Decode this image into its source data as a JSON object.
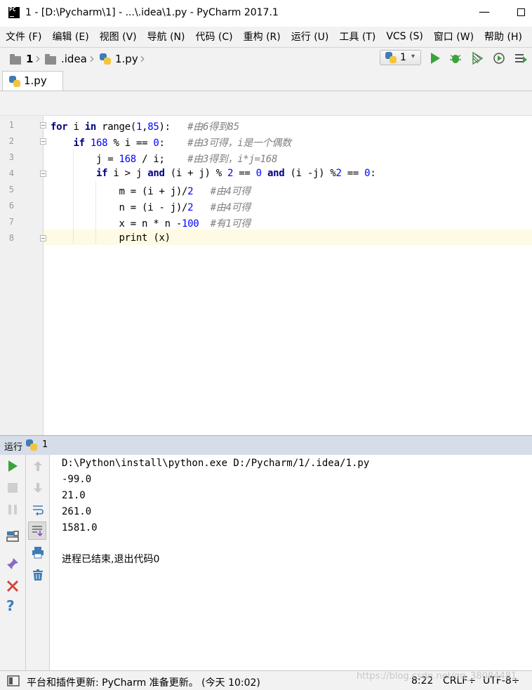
{
  "window": {
    "title": "1 - [D:\\Pycharm\\1] - ...\\.idea\\1.py - PyCharm 2017.1",
    "logo_text": "PC",
    "minimize_glyph": "—"
  },
  "menu": [
    "文件 (F)",
    "编辑 (E)",
    "视图 (V)",
    "导航 (N)",
    "代码 (C)",
    "重构 (R)",
    "运行 (U)",
    "工具 (T)",
    "VCS (S)",
    "窗口 (W)",
    "帮助 (H)"
  ],
  "navbar": {
    "crumbs": [
      "1",
      ".idea",
      "1.py"
    ],
    "run_config": "1",
    "run_config_caret": "▾"
  },
  "tabs": [
    {
      "label": "1.py"
    }
  ],
  "editor": {
    "line_numbers": [
      "1",
      "2",
      "3",
      "4",
      "5",
      "6",
      "7",
      "8"
    ],
    "lines": [
      "for i in range(1,85):   #由6得到85",
      "    if 168 % i == 0:    #由3可得，i是一个偶数",
      "        j = 168 / i;    #由3得到，i*j=168",
      "        if i > j and (i + j) % 2 == 0 and (i -j) %2 == 0:",
      "            m = (i + j)/2   #由4可得",
      "            n = (i - j)/2   #由4可得",
      "            x = n * n -100  #有1可得",
      "            print (x)"
    ]
  },
  "run_panel": {
    "label": "运行",
    "config": "1",
    "output": [
      "D:\\Python\\install\\python.exe D:/Pycharm/1/.idea/1.py",
      "-99.0",
      "21.0",
      "261.0",
      "1581.0",
      "",
      "进程已结束,退出代码0"
    ],
    "help_glyph": "?",
    "close_glyph": "✕"
  },
  "statusbar": {
    "message": "平台和插件更新: PyCharm 准备更新。 (今天 10:02)",
    "position": "8:22",
    "line_sep": "CRLF÷",
    "encoding": "UTF-8÷",
    "watermark": "https://blog.csdn.net/qq_38084481"
  },
  "colors": {
    "run_green": "#3aa33a",
    "keyword": "#000080",
    "number": "#0000ff",
    "comment": "#808080"
  }
}
